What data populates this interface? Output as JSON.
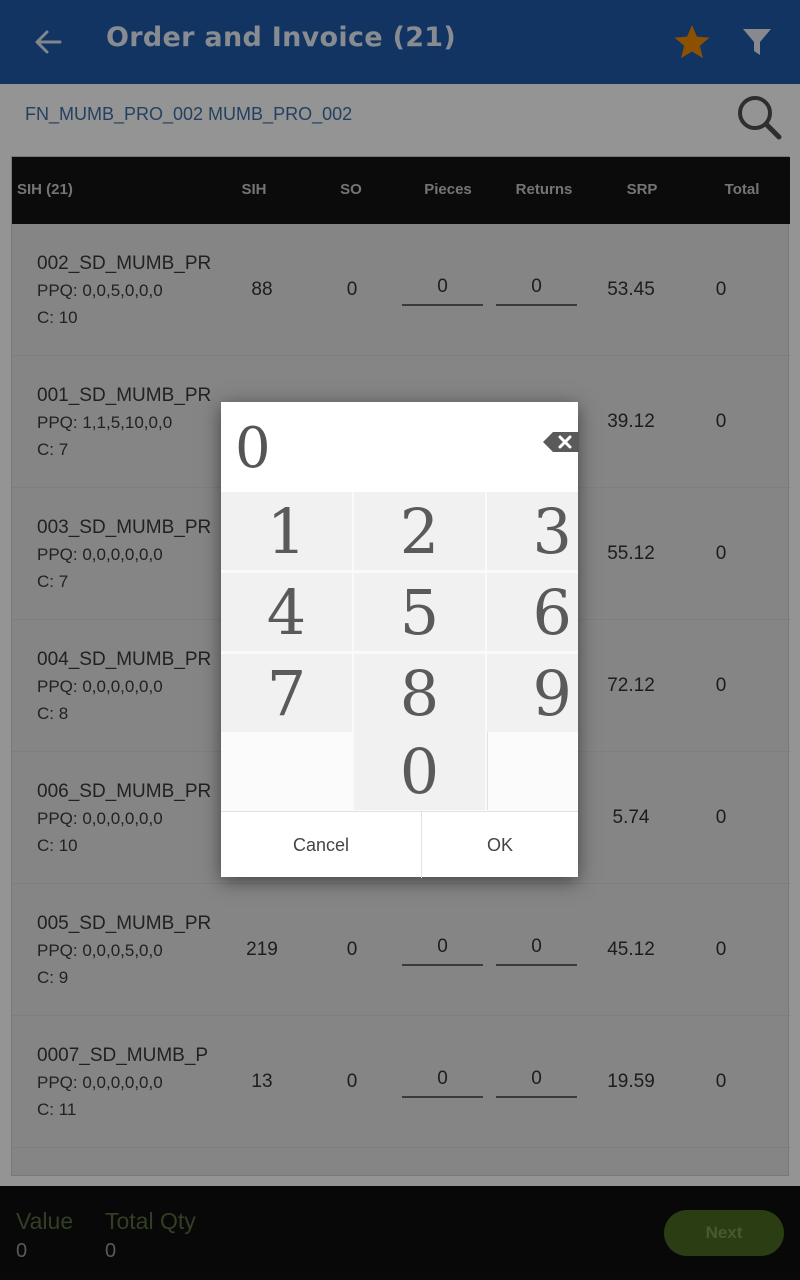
{
  "header": {
    "title": "Order and  Invoice (21)"
  },
  "distributor": "FN_MUMB_PRO_002 MUMB_PRO_002",
  "table": {
    "columns": [
      "SIH (21)",
      "SIH",
      "SO",
      "Pieces",
      "Returns",
      "SRP",
      "Total"
    ],
    "rows": [
      {
        "name": "002_SD_MUMB_PR",
        "ppq": "PPQ: 0,0,5,0,0,0",
        "c": "C: 10",
        "sih": "88",
        "so": "0",
        "pieces": "0",
        "returns": "0",
        "srp": "53.45",
        "total": "0"
      },
      {
        "name": "001_SD_MUMB_PR",
        "ppq": "PPQ: 1,1,5,10,0,0",
        "c": "C: 7",
        "sih": "",
        "so": "",
        "pieces": "",
        "returns": "",
        "srp": "39.12",
        "total": "0"
      },
      {
        "name": "003_SD_MUMB_PR",
        "ppq": "PPQ: 0,0,0,0,0,0",
        "c": "C: 7",
        "sih": "",
        "so": "",
        "pieces": "",
        "returns": "",
        "srp": "55.12",
        "total": "0"
      },
      {
        "name": "004_SD_MUMB_PR",
        "ppq": "PPQ: 0,0,0,0,0,0",
        "c": "C: 8",
        "sih": "",
        "so": "",
        "pieces": "",
        "returns": "",
        "srp": "72.12",
        "total": "0"
      },
      {
        "name": "006_SD_MUMB_PR",
        "ppq": "PPQ: 0,0,0,0,0,0",
        "c": "C: 10",
        "sih": "",
        "so": "",
        "pieces": "",
        "returns": "",
        "srp": "5.74",
        "total": "0"
      },
      {
        "name": "005_SD_MUMB_PR",
        "ppq": "PPQ: 0,0,0,5,0,0",
        "c": "C: 9",
        "sih": "219",
        "so": "0",
        "pieces": "0",
        "returns": "0",
        "srp": "45.12",
        "total": "0"
      },
      {
        "name": "0007_SD_MUMB_P",
        "ppq": "PPQ: 0,0,0,0,0,0",
        "c": "C: 11",
        "sih": "13",
        "so": "0",
        "pieces": "0",
        "returns": "0",
        "srp": "19.59",
        "total": "0"
      }
    ]
  },
  "keypad": {
    "display": "0",
    "keys": [
      "1",
      "2",
      "3",
      "4",
      "5",
      "6",
      "7",
      "8",
      "9",
      "0"
    ],
    "cancel": "Cancel",
    "ok": "OK"
  },
  "footer": {
    "value_label": "Value",
    "value": "0",
    "qty_label": "Total Qty",
    "qty": "0",
    "next": "Next"
  },
  "icons": [
    "back-arrow-icon",
    "star-icon",
    "filter-icon",
    "search-icon",
    "backspace-icon"
  ],
  "colors": {
    "appbar": "#1f5ba9",
    "star": "#f08a00",
    "next": "#4b6a1f"
  }
}
